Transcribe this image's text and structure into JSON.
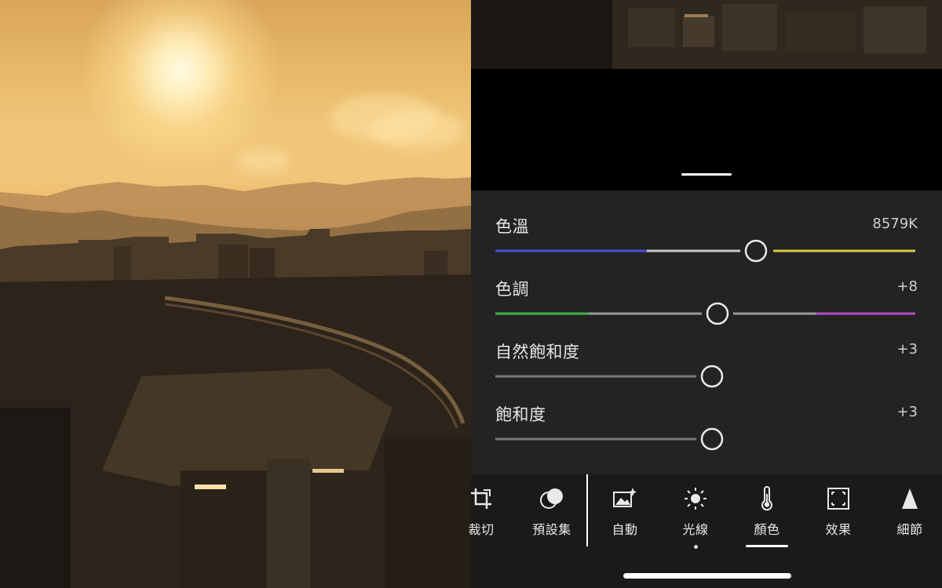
{
  "sliders": [
    {
      "label": "色溫",
      "value": "8579K",
      "position": 0.62,
      "track_left_color": "#4a4fd6",
      "track_mid_color": "#c8c8c8",
      "track_right_color": "#d8c840"
    },
    {
      "label": "色調",
      "value": "+8",
      "position": 0.52,
      "track_left_color": "#3fb34a",
      "track_mid_color": "#9a9a9a",
      "track_right_color": "#b14dc8"
    },
    {
      "label": "自然飽和度",
      "value": "+3",
      "position": 0.51,
      "track_left_color": "#8a8a8a",
      "track_mid_color": "#8a8a8a",
      "track_right_color": "#d04040"
    },
    {
      "label": "飽和度",
      "value": "+3",
      "position": 0.51,
      "track_left_color": "#8a8a8a",
      "track_mid_color": "#8a8a8a",
      "track_right_color": "#d04040"
    }
  ],
  "toolbar": {
    "tools": [
      {
        "label": "裁切",
        "icon": "crop-icon"
      },
      {
        "label": "預設集",
        "icon": "presets-icon"
      },
      {
        "label": "自動",
        "icon": "auto-icon"
      },
      {
        "label": "光線",
        "icon": "light-icon"
      },
      {
        "label": "顏色",
        "icon": "thermometer-icon",
        "active": true
      },
      {
        "label": "效果",
        "icon": "effects-icon"
      },
      {
        "label": "細節",
        "icon": "detail-icon"
      }
    ]
  },
  "colors": {
    "panel_bg": "#232323",
    "toolbar_bg": "#1a1a1a",
    "knob_stroke": "#e8e8e8",
    "text_primary": "#e6e6e6"
  }
}
